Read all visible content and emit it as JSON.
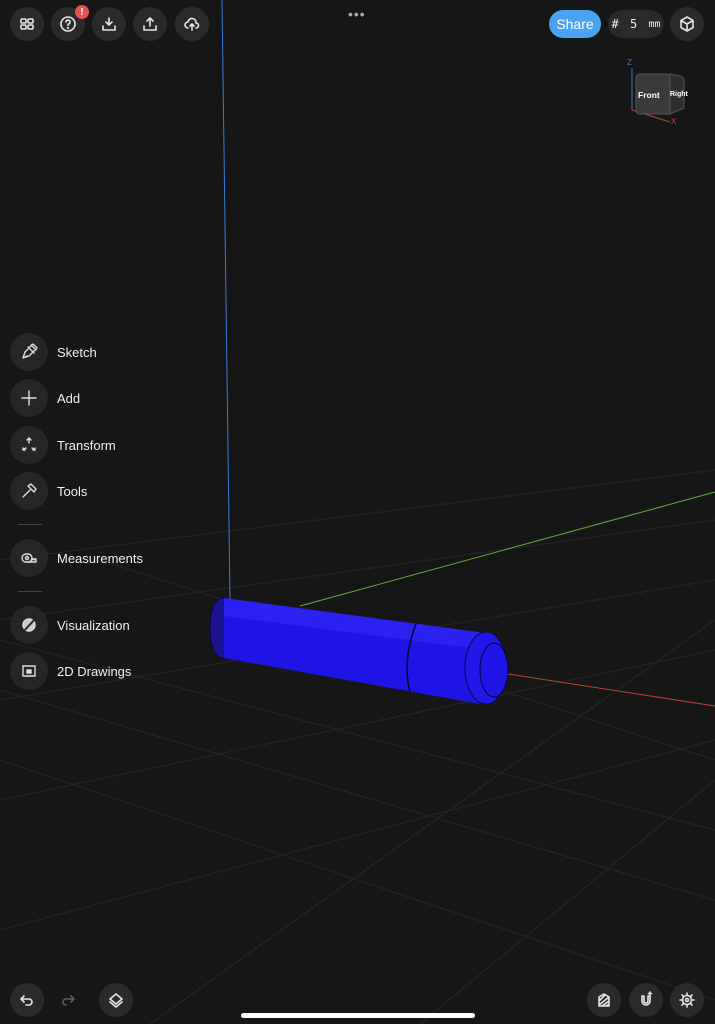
{
  "toolbar_top": {
    "buttons": [
      {
        "name": "grid-menu",
        "icon": "grid-icon"
      },
      {
        "name": "help",
        "icon": "help-icon",
        "badge": "!"
      },
      {
        "name": "import",
        "icon": "download-icon"
      },
      {
        "name": "export",
        "icon": "upload-icon"
      },
      {
        "name": "cloud",
        "icon": "cloud-upload-icon"
      }
    ],
    "more": "•••",
    "share_label": "Share",
    "grid_symbol": "#",
    "grid_value": "5",
    "grid_unit": "mm"
  },
  "view_cube": {
    "front": "Front",
    "right": "Right",
    "axis_z": "Z",
    "axis_x": "X"
  },
  "side_menu": [
    {
      "label": "Sketch",
      "icon": "pencil-icon"
    },
    {
      "label": "Add",
      "icon": "plus-icon"
    },
    {
      "label": "Transform",
      "icon": "transform-icon"
    },
    {
      "label": "Tools",
      "icon": "hammer-icon"
    },
    {
      "label": "Measurements",
      "icon": "tape-measure-icon"
    },
    {
      "label": "Visualization",
      "icon": "brush-icon"
    },
    {
      "label": "2D Drawings",
      "icon": "drawing-icon"
    }
  ],
  "colors": {
    "accent": "#4aa3f0",
    "model": "#1a12e0",
    "axis_x": "#c0443a",
    "axis_y": "#5fae3f",
    "axis_z": "#3b78d8"
  }
}
